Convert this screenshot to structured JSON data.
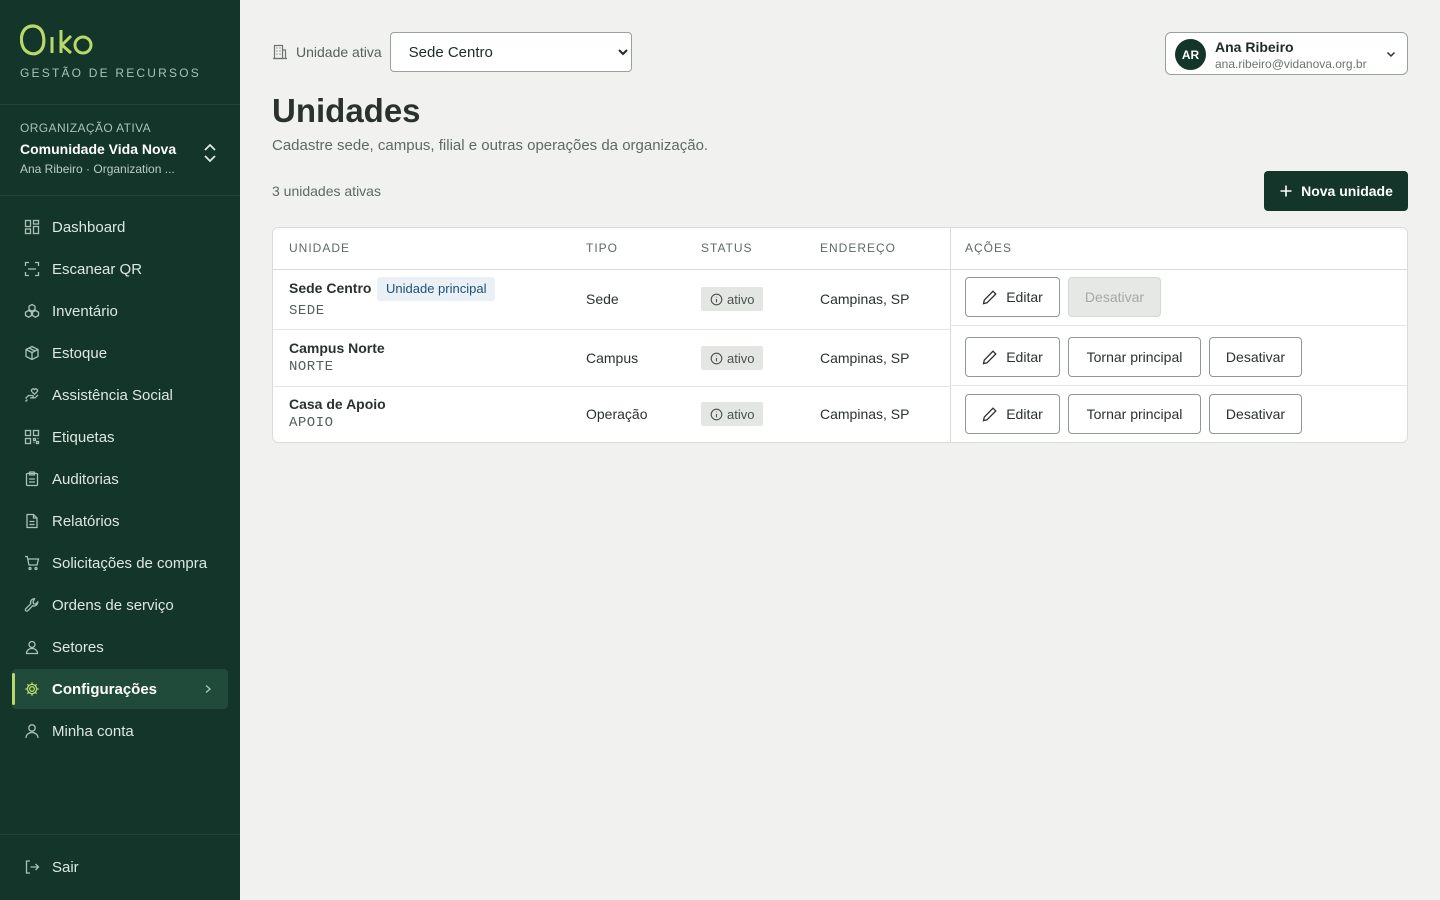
{
  "brand": {
    "logo_text": "Oiko",
    "subtitle": "GESTÃO DE RECURSOS",
    "accent": "#b8d96a",
    "sidebar_bg": "#14352a"
  },
  "org": {
    "label": "ORGANIZAÇÃO ATIVA",
    "name": "Comunidade Vida Nova",
    "user_line": "Ana Ribeiro · Organization ..."
  },
  "nav": [
    {
      "label": "Dashboard",
      "icon": "dashboard-icon"
    },
    {
      "label": "Escanear QR",
      "icon": "scan-icon"
    },
    {
      "label": "Inventário",
      "icon": "boxes-icon"
    },
    {
      "label": "Estoque",
      "icon": "package-icon"
    },
    {
      "label": "Assistência Social",
      "icon": "hand-heart-icon"
    },
    {
      "label": "Etiquetas",
      "icon": "qr-code-icon"
    },
    {
      "label": "Auditorias",
      "icon": "clipboard-icon"
    },
    {
      "label": "Relatórios",
      "icon": "file-text-icon"
    },
    {
      "label": "Solicitações de compra",
      "icon": "cart-icon"
    },
    {
      "label": "Ordens de serviço",
      "icon": "wrench-icon"
    },
    {
      "label": "Setores",
      "icon": "user-group-icon"
    },
    {
      "label": "Configurações",
      "icon": "gear-icon",
      "active": true
    },
    {
      "label": "Minha conta",
      "icon": "user-icon"
    }
  ],
  "logout": {
    "label": "Sair",
    "icon": "logout-icon"
  },
  "topbar": {
    "unit_label": "Unidade ativa",
    "unit_selected": "Sede Centro"
  },
  "user": {
    "initials": "AR",
    "name": "Ana Ribeiro",
    "email": "ana.ribeiro@vidanova.org.br"
  },
  "page": {
    "title": "Unidades",
    "description": "Cadastre sede, campus, filial e outras operações da organização.",
    "count_text": "3 unidades ativas",
    "new_button": "Nova unidade"
  },
  "table": {
    "headers": {
      "unit": "UNIDADE",
      "type": "TIPO",
      "status": "STATUS",
      "address": "ENDEREÇO",
      "actions": "AÇÕES"
    },
    "rows": [
      {
        "name": "Sede Centro",
        "code": "SEDE",
        "badge": "Unidade principal",
        "type": "Sede",
        "status": "ativo",
        "address": "Campinas, SP",
        "edit": "Editar",
        "deactivate": "Desativar",
        "deactivate_disabled": true
      },
      {
        "name": "Campus Norte",
        "code": "NORTE",
        "type": "Campus",
        "status": "ativo",
        "address": "Campinas, SP",
        "edit": "Editar",
        "make_main": "Tornar principal",
        "deactivate": "Desativar"
      },
      {
        "name": "Casa de Apoio",
        "code": "APOIO",
        "type": "Operação",
        "status": "ativo",
        "address": "Campinas, SP",
        "edit": "Editar",
        "make_main": "Tornar principal",
        "deactivate": "Desativar"
      }
    ]
  }
}
